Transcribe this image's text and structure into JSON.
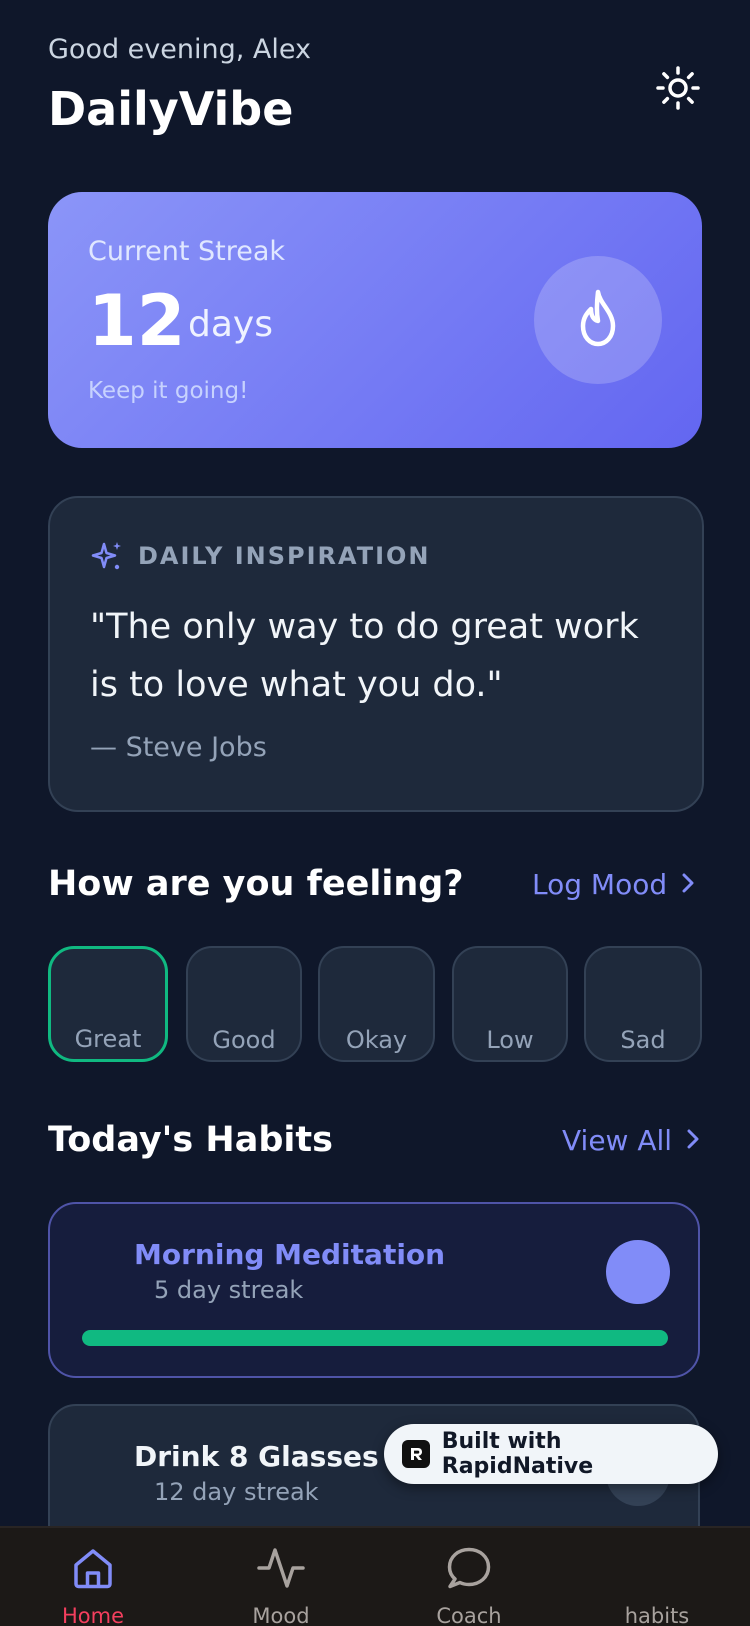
{
  "header": {
    "greeting": "Good evening, Alex",
    "title": "DailyVibe",
    "theme_icon": "sun-icon"
  },
  "streak": {
    "label": "Current Streak",
    "count": "12",
    "unit": "days",
    "subtitle": "Keep it going!",
    "icon": "flame-icon"
  },
  "inspiration": {
    "heading": "DAILY INSPIRATION",
    "quote": "\"The only way to do great work is to love what you do.\"",
    "author": "— Steve Jobs",
    "icon": "sparkles-icon"
  },
  "mood": {
    "title": "How are you feeling?",
    "link": "Log Mood",
    "options": [
      {
        "label": "Great",
        "selected": true
      },
      {
        "label": "Good",
        "selected": false
      },
      {
        "label": "Okay",
        "selected": false
      },
      {
        "label": "Low",
        "selected": false
      },
      {
        "label": "Sad",
        "selected": false
      }
    ]
  },
  "habits": {
    "title": "Today's Habits",
    "link": "View All",
    "items": [
      {
        "name": "Morning Meditation",
        "streak": "5 day streak",
        "progress": 1.0,
        "done": true
      },
      {
        "name": "Drink 8 Glasses",
        "streak": "12 day streak",
        "done": false
      }
    ]
  },
  "badge": {
    "text": "Built with RapidNative"
  },
  "tabs": [
    {
      "label": "Home",
      "icon": "home-icon",
      "active": true
    },
    {
      "label": "Mood",
      "icon": "activity-icon",
      "active": false
    },
    {
      "label": "Coach",
      "icon": "chat-icon",
      "active": false
    },
    {
      "label": "habits",
      "icon": "",
      "active": false
    }
  ],
  "colors": {
    "background": "#0f172a",
    "accent": "#818cf8",
    "success": "#10b981",
    "active_tab": "#f43f5e"
  }
}
